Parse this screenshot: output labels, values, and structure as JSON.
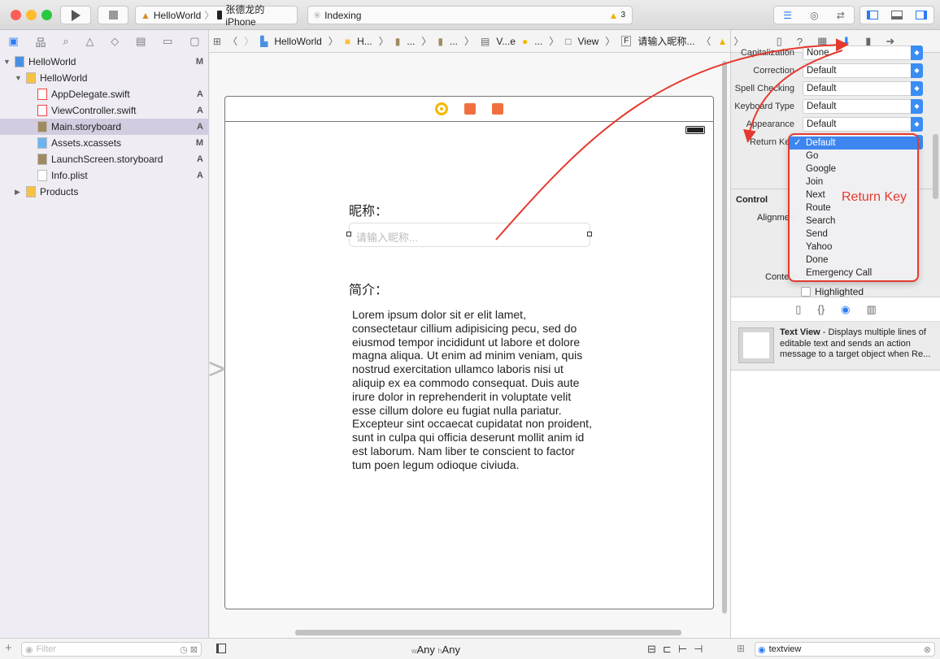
{
  "toolbar": {
    "scheme": "HelloWorld",
    "device": "张德龙的 iPhone",
    "activity": "Indexing",
    "warnings": "3"
  },
  "jumpbar": [
    "HelloWorld",
    "H...",
    "...",
    "...",
    "V...e",
    "...",
    "View",
    "请输入昵称..."
  ],
  "jumpbar_f": "F",
  "navigator": {
    "items": [
      {
        "label": "HelloWorld",
        "status": "M",
        "level": 0,
        "icon": "project-icon"
      },
      {
        "label": "HelloWorld",
        "status": "",
        "level": 1,
        "icon": "folder-icon"
      },
      {
        "label": "AppDelegate.swift",
        "status": "A",
        "level": 2,
        "icon": "swift-file-icon"
      },
      {
        "label": "ViewController.swift",
        "status": "A",
        "level": 2,
        "icon": "swift-file-icon"
      },
      {
        "label": "Main.storyboard",
        "status": "A",
        "level": 2,
        "icon": "storyboard-icon",
        "selected": true
      },
      {
        "label": "Assets.xcassets",
        "status": "M",
        "level": 2,
        "icon": "assets-folder-icon"
      },
      {
        "label": "LaunchScreen.storyboard",
        "status": "A",
        "level": 2,
        "icon": "storyboard-icon"
      },
      {
        "label": "Info.plist",
        "status": "A",
        "level": 2,
        "icon": "plist-icon"
      },
      {
        "label": "Products",
        "status": "",
        "level": 1,
        "icon": "folder-icon"
      }
    ],
    "filter_placeholder": "Filter"
  },
  "canvas": {
    "nickname_label": "昵称：",
    "nickname_placeholder": "请输入昵称...",
    "intro_label": "简介：",
    "intro_text": "Lorem ipsum dolor sit er elit lamet, consectetaur cillium adipisicing pecu, sed do eiusmod tempor incididunt ut labore et dolore magna aliqua. Ut enim ad minim veniam, quis nostrud exercitation ullamco laboris nisi ut aliquip ex ea commodo consequat. Duis aute irure dolor in reprehenderit in voluptate velit esse cillum dolore eu fugiat nulla pariatur. Excepteur sint occaecat cupidatat non proident, sunt in culpa qui officia deserunt mollit anim id est laborum. Nam liber te conscient to factor tum poen legum odioque civiuda.",
    "size_class": {
      "w_prefix": "w",
      "w": "Any",
      "h_prefix": "h",
      "h": "Any"
    }
  },
  "inspector": {
    "props": [
      {
        "label": "Capitalization",
        "value": "None"
      },
      {
        "label": "Correction",
        "value": "Default"
      },
      {
        "label": "Spell Checking",
        "value": "Default"
      },
      {
        "label": "Keyboard Type",
        "value": "Default"
      },
      {
        "label": "Appearance",
        "value": "Default"
      },
      {
        "label": "Return Key",
        "value": "Default"
      }
    ],
    "control_section": "Control",
    "alignment_label": "Alignment",
    "content_label": "Content",
    "highlighted_label": "Highlighted",
    "return_key_options": [
      "Default",
      "Go",
      "Google",
      "Join",
      "Next",
      "Route",
      "Search",
      "Send",
      "Yahoo",
      "Done",
      "Emergency Call"
    ],
    "return_key_selected": "Default",
    "annotation": "Return Key",
    "annotation_color": "#e5392f",
    "library_item": {
      "title": "Text View",
      "description": " - Displays multiple lines of editable text and sends an action message to a target object when Re..."
    },
    "library_search": "textview"
  }
}
